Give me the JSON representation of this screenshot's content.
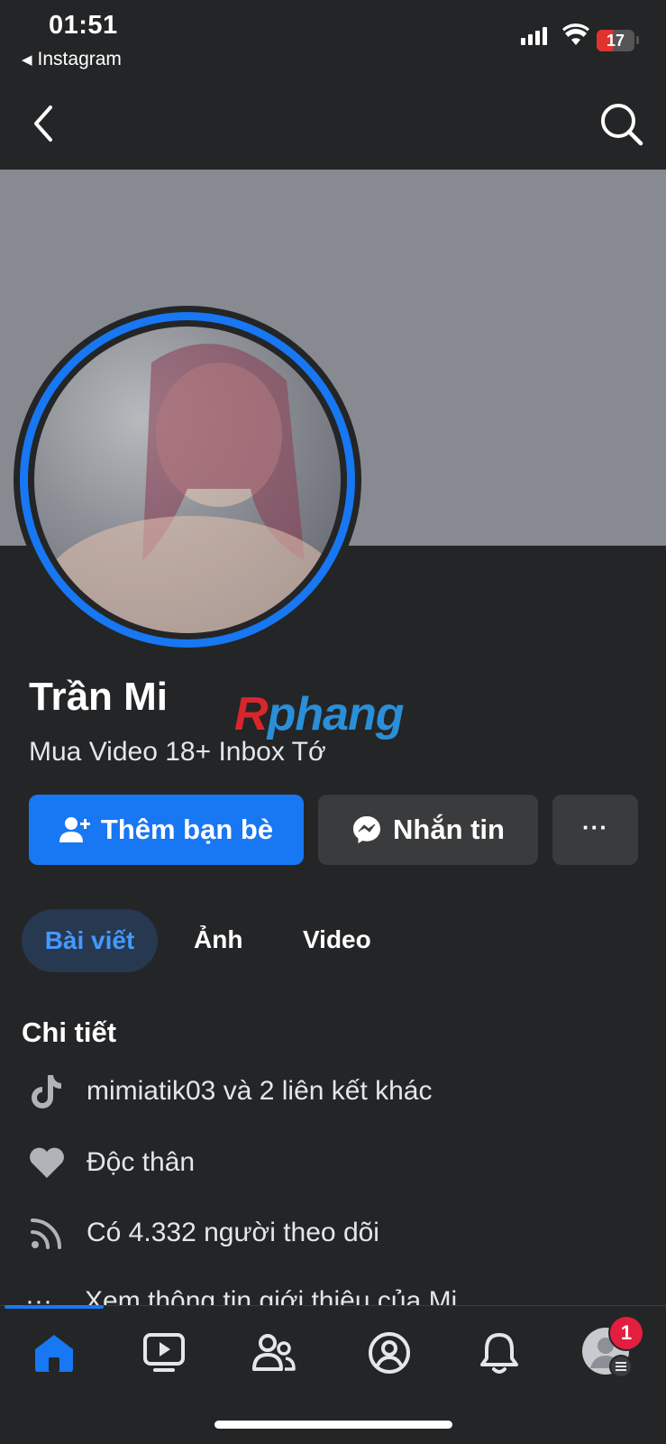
{
  "status_bar": {
    "time": "01:51",
    "back_app": "Instagram",
    "battery": "17"
  },
  "profile": {
    "name": "Trần Mi",
    "bio": "Mua Video 18+ Inbox Tớ"
  },
  "watermark": {
    "part1": "R",
    "part2": "phang"
  },
  "actions": {
    "add_friend": "Thêm bạn bè",
    "message": "Nhắn tin",
    "more": "···"
  },
  "tabs": [
    {
      "label": "Bài viết",
      "active": true
    },
    {
      "label": "Ảnh"
    },
    {
      "label": "Video"
    }
  ],
  "details": {
    "title": "Chi tiết",
    "items": [
      {
        "icon": "tiktok-icon",
        "text": "mimiatik03 và 2 liên kết khác"
      },
      {
        "icon": "heart-icon",
        "text": "Độc thân"
      },
      {
        "icon": "rss-icon",
        "text": "Có 4.332 người theo dõi"
      }
    ],
    "more": "Xem thông tin giới thiệu của Mi"
  },
  "nav": {
    "notifications_badge": "1",
    "active_color": "#1877f2"
  },
  "colors": {
    "background": "#242526",
    "accent": "#1877f2",
    "cover": "#878a90",
    "secondary_button": "#3a3b3c"
  }
}
